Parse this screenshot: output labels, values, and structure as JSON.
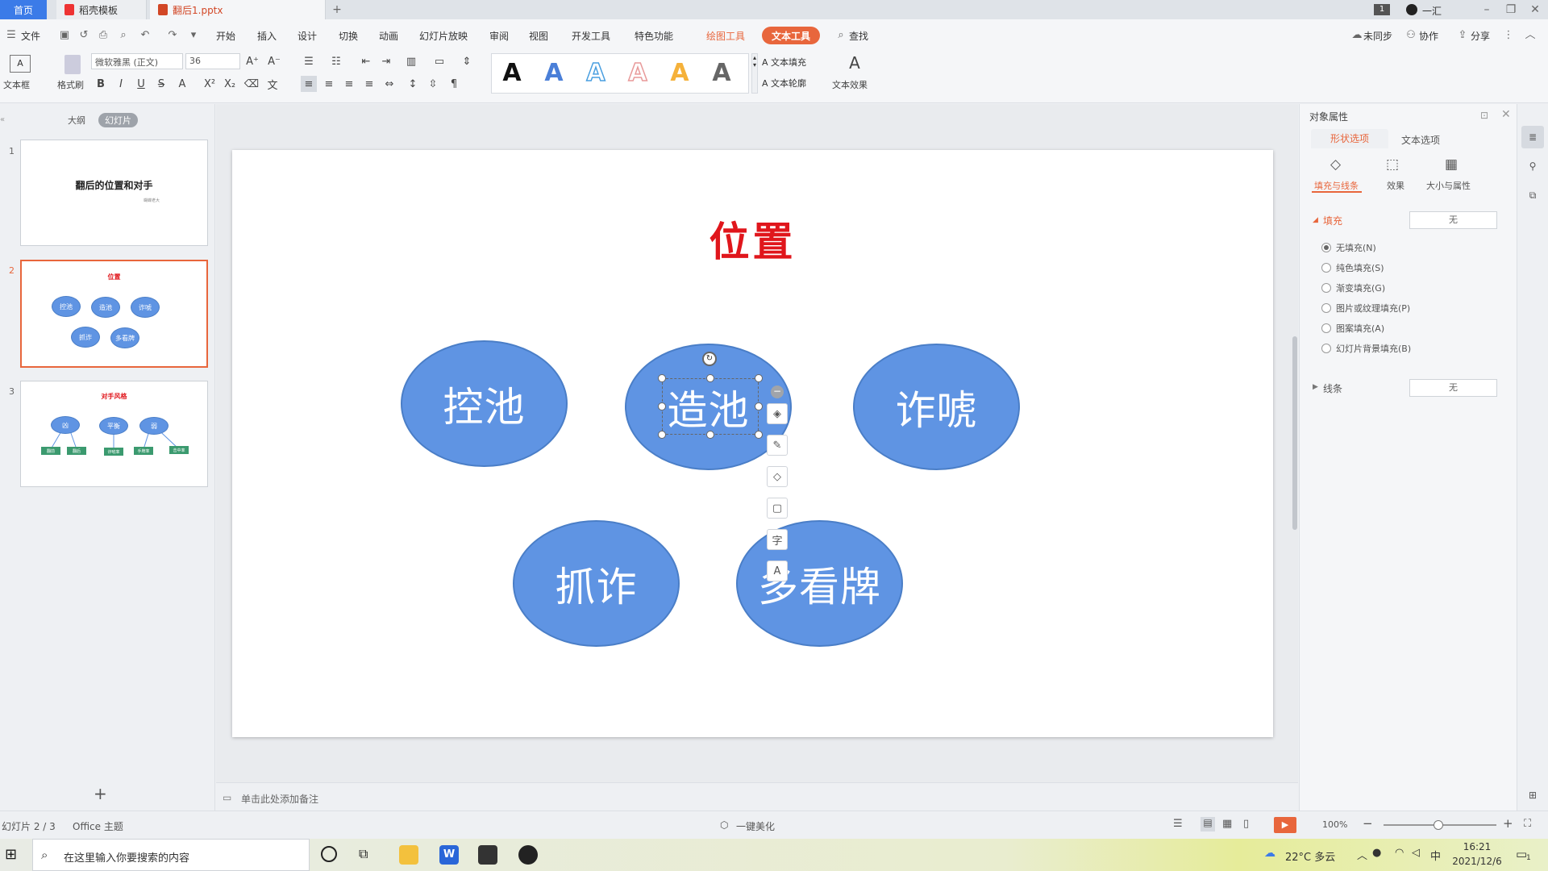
{
  "titlebar": {
    "home_tab": "首页",
    "tabs": [
      {
        "label": "稻壳模板"
      },
      {
        "label": "翻后1.pptx"
      }
    ],
    "badge": "1",
    "user": "一汇"
  },
  "menubar": {
    "file": "文件",
    "items": [
      "开始",
      "插入",
      "设计",
      "切换",
      "动画",
      "幻灯片放映",
      "审阅",
      "视图",
      "开发工具",
      "特色功能"
    ],
    "drawing_tools": "绘图工具",
    "text_tools": "文本工具",
    "search": "查找",
    "sync": "未同步",
    "collab": "协作",
    "share": "分享"
  },
  "ribbon": {
    "textbox": "文本框",
    "format_painter": "格式刷",
    "font_name": "微软雅黑 (正文)",
    "font_size": "36",
    "text_fill": "文本填充",
    "text_outline": "文本轮廓",
    "text_effect": "文本效果",
    "art_letter": "A"
  },
  "leftpanel": {
    "outline": "大纲",
    "slides": "幻灯片",
    "thumbs": [
      {
        "num": "1",
        "title": "翻后的位置和对手",
        "subtitle": "蝴蝶老大"
      },
      {
        "num": "2",
        "title": "位置",
        "items": [
          "控池",
          "造池",
          "诈唬",
          "抓诈",
          "多看牌"
        ]
      },
      {
        "num": "3",
        "title": "对手风格",
        "items": [
          "凶",
          "平衡",
          "弱"
        ],
        "boxes": [
          "翻前",
          "翻后",
          "诈唬率",
          "手牌率",
          "击中率"
        ]
      }
    ],
    "add": "+"
  },
  "slide": {
    "title": "位置",
    "ellipses": [
      "控池",
      "造池",
      "诈唬",
      "抓诈",
      "多看牌"
    ]
  },
  "notes_placeholder": "单击此处添加备注",
  "rightpanel": {
    "header": "对象属性",
    "tab_shape": "形状选项",
    "tab_text": "文本选项",
    "sub_fill_line": "填充与线条",
    "sub_effect": "效果",
    "sub_size": "大小与属性",
    "fill_label": "填充",
    "fill_value": "无",
    "options": [
      "无填充(N)",
      "纯色填充(S)",
      "渐变填充(G)",
      "图片或纹理填充(P)",
      "图案填充(A)",
      "幻灯片背景填充(B)"
    ],
    "line_label": "线条",
    "line_value": "无"
  },
  "statusbar": {
    "slide_info": "幻灯片 2 / 3",
    "theme": "Office 主题",
    "beautify": "一键美化",
    "zoom": "100%"
  },
  "taskbar": {
    "search_placeholder": "在这里输入你要搜索的内容",
    "weather": "22°C 多云",
    "ime": "中",
    "time": "16:21",
    "date": "2021/12/6",
    "notif": "1"
  },
  "colors": {
    "accent": "#3b7be8",
    "orange": "#e8663c",
    "ellipse": "#5f94e3",
    "title_red": "#e0161c"
  }
}
